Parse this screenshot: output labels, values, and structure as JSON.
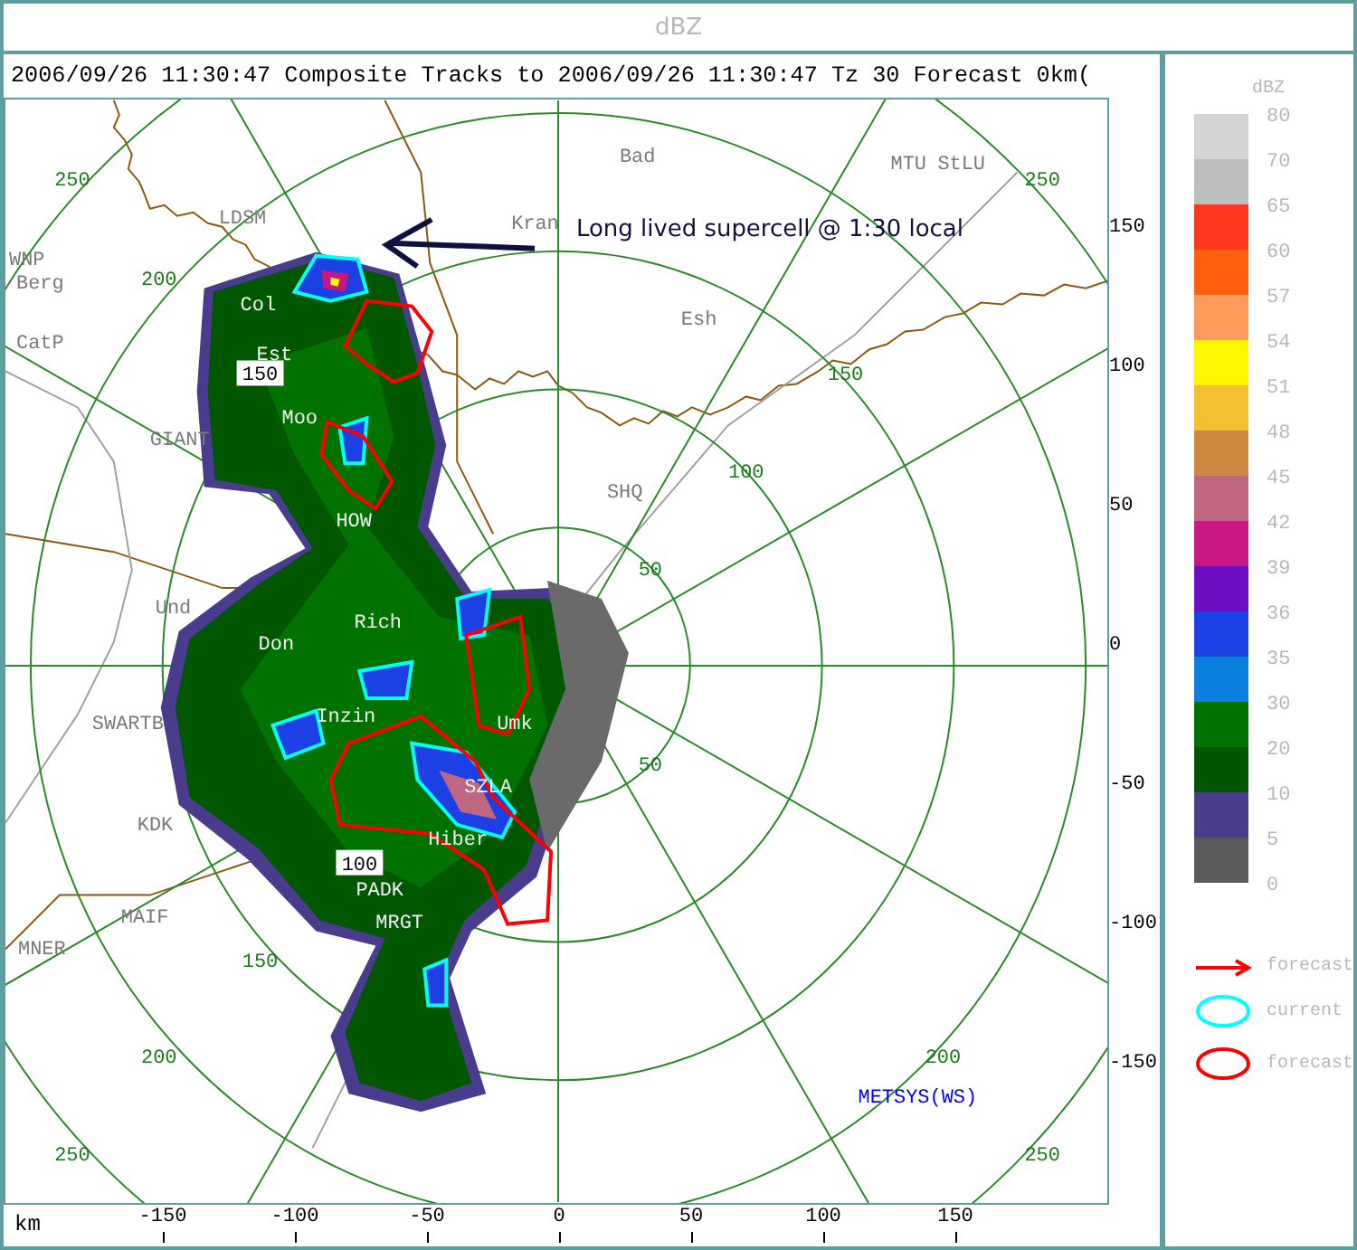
{
  "header": {
    "title": "dBZ"
  },
  "plot": {
    "title": "2006/09/26 11:30:47  Composite Tracks to 2006/09/26 11:30:47 Tz 30 Forecast 0km(",
    "range_labels": [
      {
        "text": "250",
        "kind": "plain"
      },
      {
        "text": "200",
        "kind": "plain"
      },
      {
        "text": "150",
        "kind": "boxed"
      },
      {
        "text": "50",
        "kind": "plain"
      },
      {
        "text": "100",
        "kind": "plain"
      },
      {
        "text": "150",
        "kind": "plain"
      },
      {
        "text": "250",
        "kind": "plain"
      },
      {
        "text": "50",
        "kind": "plain"
      },
      {
        "text": "100",
        "kind": "boxed"
      },
      {
        "text": "150",
        "kind": "plain"
      },
      {
        "text": "200",
        "kind": "plain"
      },
      {
        "text": "200",
        "kind": "plain"
      },
      {
        "text": "250",
        "kind": "plain"
      },
      {
        "text": "250",
        "kind": "plain"
      }
    ],
    "places": [
      "Bad",
      "MTU",
      "StLU",
      "Kran",
      "LDSM",
      "WNP",
      "Berg",
      "CatP",
      "Col",
      "Est",
      "Moo",
      "GIANT",
      "HOW",
      "SHQ",
      "Und",
      "Rich",
      "Don",
      "SWARTB",
      "Inzin",
      "Umk",
      "SZLA",
      "Hiber",
      "KDK",
      "PADK",
      "MRGT",
      "MAIF",
      "MNER",
      "Esh"
    ],
    "annotation": "Long lived supercell @ 1:30 local",
    "credit": "METSYS(WS)",
    "x_axis": {
      "unit": "km",
      "ticks": [
        "-150",
        "-100",
        "-50",
        "0",
        "50",
        "100",
        "150"
      ]
    },
    "y_axis": {
      "ticks": [
        "150",
        "100",
        "50",
        "0",
        "-50",
        "-100",
        "-150"
      ]
    }
  },
  "legend": {
    "title": "dBZ",
    "levels": [
      {
        "label": "80",
        "color": "#d4d3d6"
      },
      {
        "label": "70",
        "color": "#bebebe"
      },
      {
        "label": "65",
        "color": "#ff3720"
      },
      {
        "label": "60",
        "color": "#ff5f0a"
      },
      {
        "label": "57",
        "color": "#ff9a5a"
      },
      {
        "label": "54",
        "color": "#fff700"
      },
      {
        "label": "51",
        "color": "#f5c030"
      },
      {
        "label": "48",
        "color": "#cc8840"
      },
      {
        "label": "45",
        "color": "#bf6680"
      },
      {
        "label": "42",
        "color": "#c81683"
      },
      {
        "label": "39",
        "color": "#6c0fc3"
      },
      {
        "label": "36",
        "color": "#1c40e4"
      },
      {
        "label": "35",
        "color": "#0a7fde"
      },
      {
        "label": "30",
        "color": "#007200"
      },
      {
        "label": "20",
        "color": "#005700"
      },
      {
        "label": "10",
        "color": "#4a3c8c"
      },
      {
        "label": "5",
        "color": "#5a5a5a"
      }
    ],
    "bottom_label": "0",
    "items": [
      {
        "kind": "arrow",
        "color": "#ff0000",
        "label": "forecast"
      },
      {
        "kind": "ellipse",
        "color": "#00ffff",
        "label": "current"
      },
      {
        "kind": "ellipse",
        "color": "#ff0000",
        "label": "forecast"
      }
    ]
  }
}
